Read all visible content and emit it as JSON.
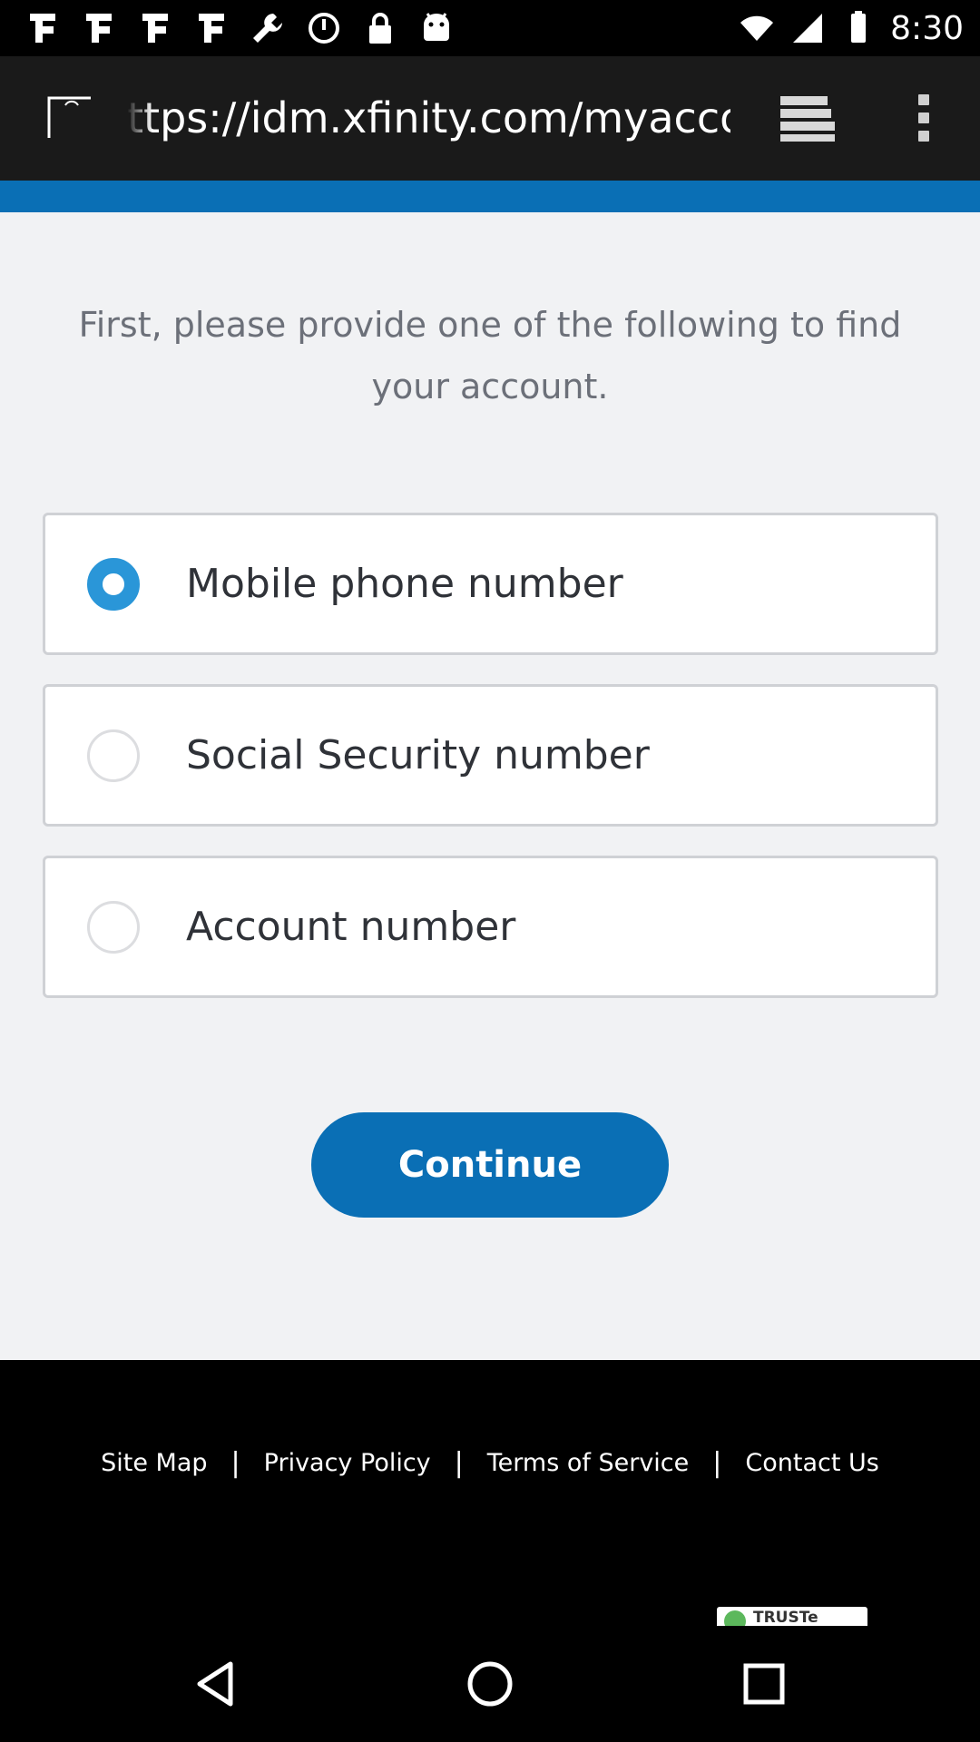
{
  "status_bar": {
    "time": "8:30",
    "icons": [
      "notification-icon",
      "notification-icon",
      "notification-icon",
      "notification-icon",
      "wrench-icon",
      "alarm-icon",
      "lock-icon",
      "android-icon"
    ],
    "right_icons": [
      "wifi-icon",
      "signal-icon",
      "battery-icon"
    ]
  },
  "browser": {
    "url": "ttps://idm.xfinity.com/myaccount/lookup",
    "tab_icon": "tab-icon",
    "reader_icon": "reader-mode-icon",
    "menu_icon": "overflow-menu-icon"
  },
  "colors": {
    "brand_blue": "#0a6fb5",
    "radio_blue": "#2a96d8",
    "page_bg": "#f1f2f4"
  },
  "main": {
    "prompt": "First, please provide one of the following to find your account.",
    "options": [
      {
        "label": "Mobile phone number",
        "selected": true
      },
      {
        "label": "Social Security number",
        "selected": false
      },
      {
        "label": "Account number",
        "selected": false
      }
    ],
    "continue_label": "Continue"
  },
  "footer": {
    "links": [
      "Site Map",
      "Privacy Policy",
      "Terms of Service",
      "Contact Us"
    ],
    "separator": "|",
    "badge_text": "TRUSTe"
  },
  "navbar": {
    "icons": [
      "back-icon",
      "home-icon",
      "recents-icon"
    ]
  }
}
